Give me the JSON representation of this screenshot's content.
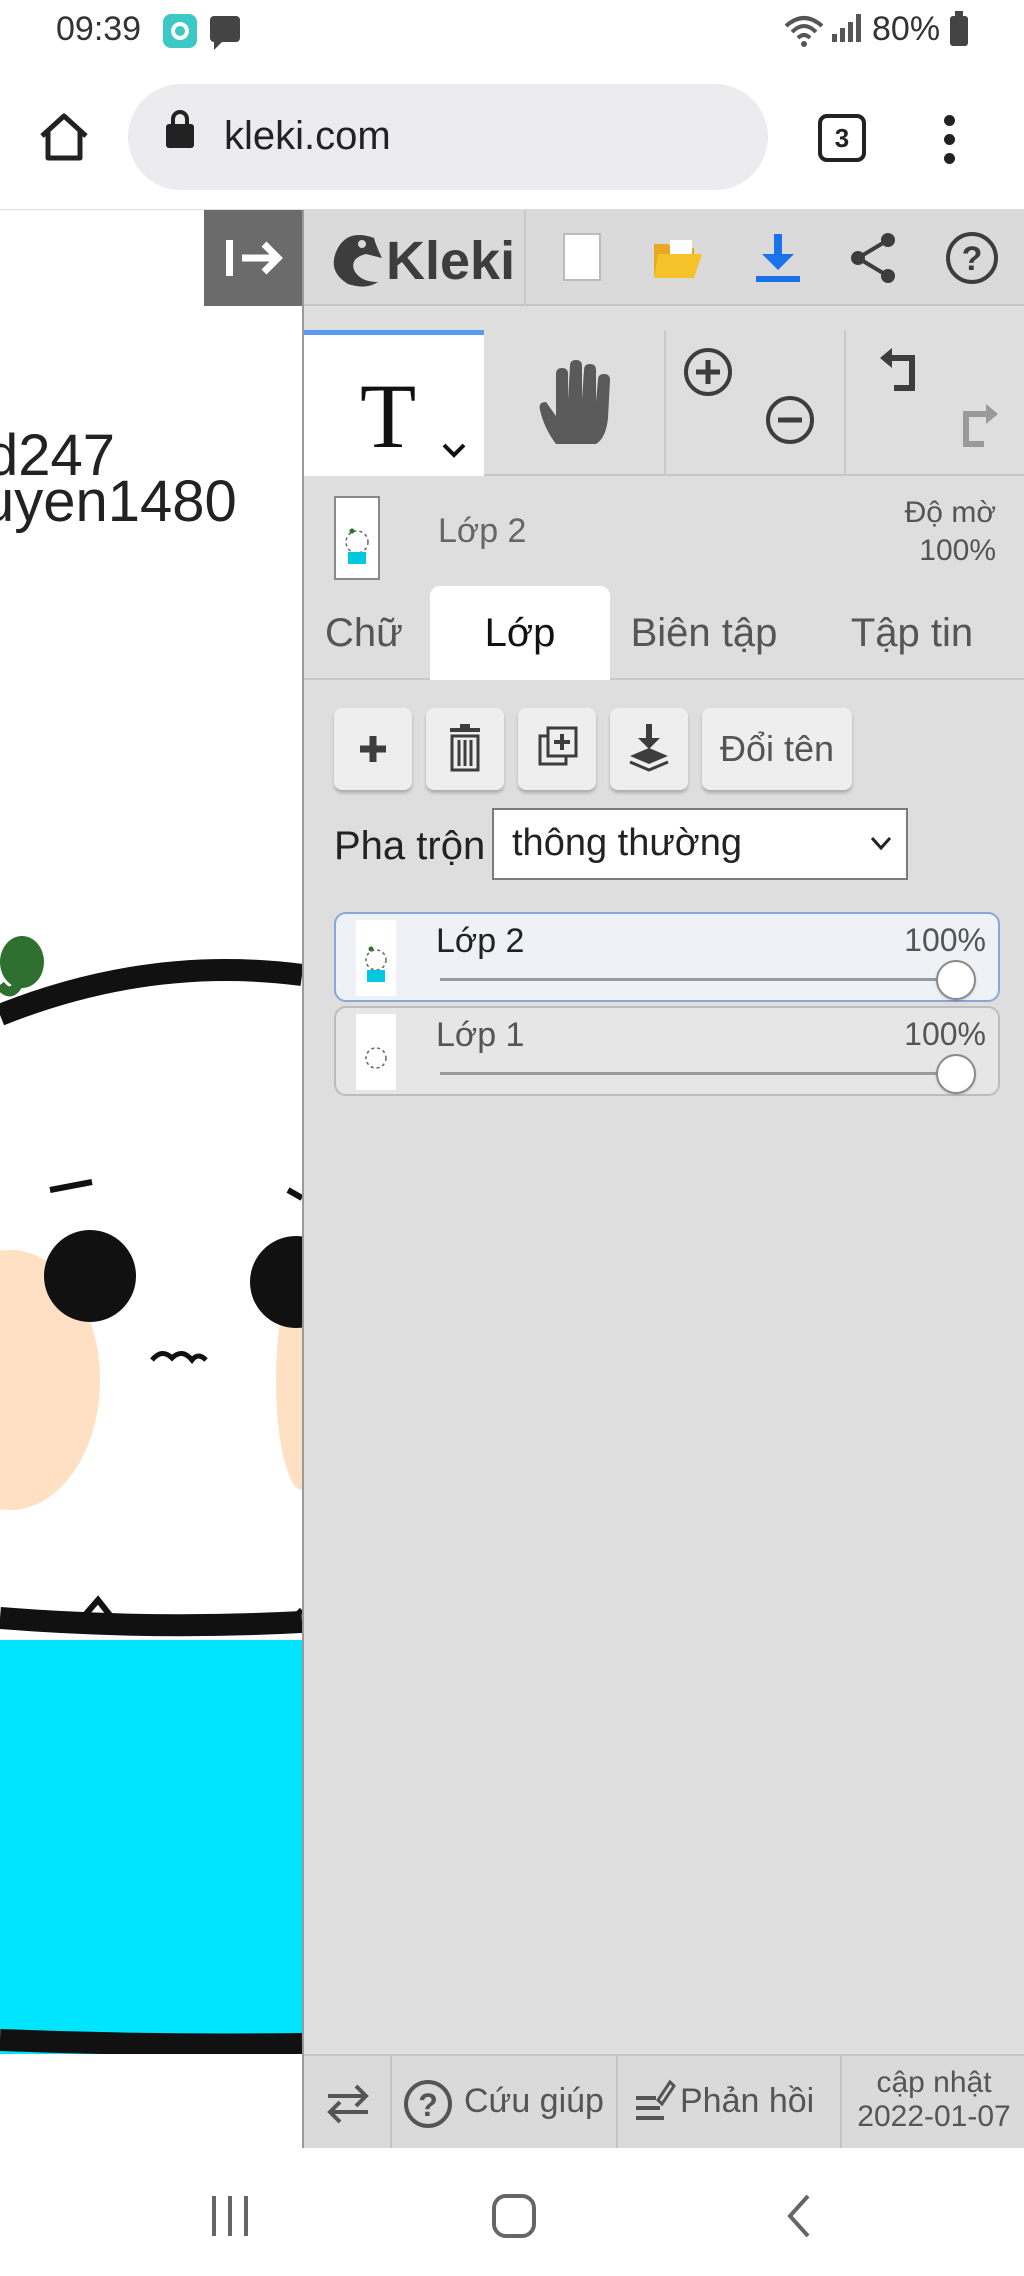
{
  "status_bar": {
    "time": "09:39",
    "battery": "80%"
  },
  "browser": {
    "url": "kleki.com",
    "tab_count": "3"
  },
  "canvas": {
    "text_lines": [
      "d247",
      "uyen1480"
    ]
  },
  "app": {
    "logo": "Kleki",
    "current_tool": "T"
  },
  "layer_info": {
    "name": "Lớp 2",
    "opacity_label": "Độ mờ",
    "opacity_value": "100%"
  },
  "tabs": [
    {
      "label": "Chữ",
      "active": false
    },
    {
      "label": "Lớp",
      "active": true
    },
    {
      "label": "Biên tập",
      "active": false
    },
    {
      "label": "Tập tin",
      "active": false
    }
  ],
  "layer_buttons": {
    "rename_label": "Đổi tên"
  },
  "blend": {
    "label": "Pha trộn",
    "value": "thông thường"
  },
  "layers": [
    {
      "name": "Lớp 2",
      "opacity": "100%",
      "opacity_value": 1.0,
      "selected": true
    },
    {
      "name": "Lớp 1",
      "opacity": "100%",
      "opacity_value": 1.0,
      "selected": false
    }
  ],
  "footer": {
    "help_label": "Cứu giúp",
    "feedback_label": "Phản hồi",
    "update_label": "cập nhật",
    "update_date": "2022-01-07"
  },
  "colors": {
    "accent": "#5a9af0",
    "download_blue": "#1a73e8",
    "folder_yellow": "#f5c229",
    "canvas_cyan": "#00e5ff"
  },
  "icons": [
    "home-icon",
    "lock-icon",
    "more-vert-icon",
    "collapse-panel-icon",
    "new-image-icon",
    "open-folder-icon",
    "download-icon",
    "share-icon",
    "help-icon",
    "hand-icon",
    "zoom-in-icon",
    "zoom-out-icon",
    "undo-icon",
    "redo-icon",
    "add-layer-icon",
    "trash-icon",
    "duplicate-icon",
    "merge-down-icon",
    "swap-icon",
    "feedback-icon"
  ]
}
